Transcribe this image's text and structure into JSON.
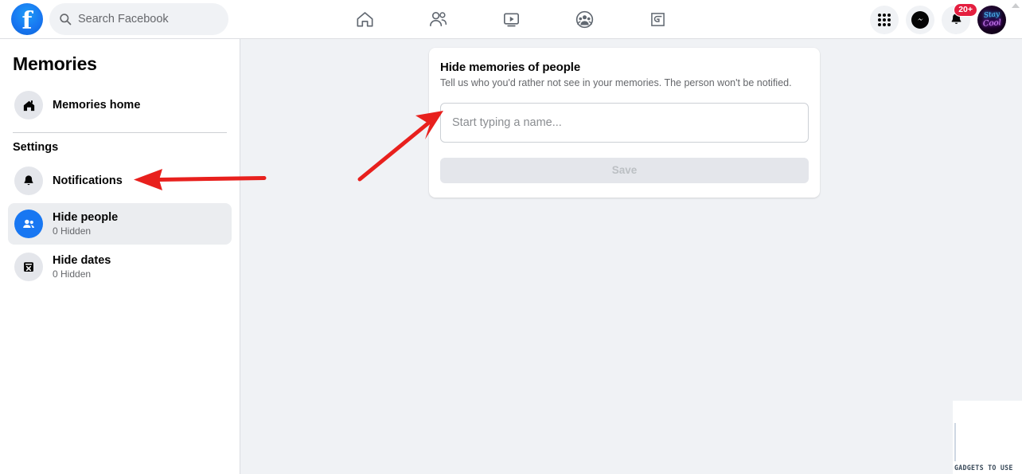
{
  "header": {
    "logo_icon": "facebook-logo-icon",
    "search": {
      "icon": "search-icon",
      "placeholder": "Search Facebook",
      "value": "Search Facebook"
    },
    "nav": [
      {
        "name": "home-icon",
        "label": "Home"
      },
      {
        "name": "friends-icon",
        "label": "Friends"
      },
      {
        "name": "watch-video-icon",
        "label": "Watch"
      },
      {
        "name": "groups-icon",
        "label": "Groups"
      },
      {
        "name": "gaming-icon",
        "label": "Gaming"
      }
    ],
    "right": {
      "menu_icon": "apps-grid-icon",
      "messenger_icon": "messenger-icon",
      "notifications_icon": "bell-icon",
      "notifications_badge": "20+",
      "avatar_icon": "profile-avatar",
      "avatar_line1": "Stay",
      "avatar_line2": "Cool"
    }
  },
  "sidebar": {
    "title": "Memories",
    "home_item": {
      "icon": "house-icon",
      "label": "Memories home"
    },
    "section_label": "Settings",
    "items": [
      {
        "icon": "bell-icon",
        "label": "Notifications",
        "sub": "",
        "active": false
      },
      {
        "icon": "people-icon",
        "label": "Hide people",
        "sub": "0 Hidden",
        "active": true
      },
      {
        "icon": "calendar-x-icon",
        "label": "Hide dates",
        "sub": "0 Hidden",
        "active": false
      }
    ]
  },
  "main": {
    "card": {
      "title": "Hide memories of people",
      "subtitle": "Tell us who you'd rather not see in your memories. The person won't be notified.",
      "input_placeholder": "Start typing a name...",
      "input_value": "",
      "save_label": "Save",
      "save_disabled": true
    }
  },
  "annotations": [
    {
      "name": "arrow-to-hide-people",
      "direction": "left",
      "color": "#e8201d"
    },
    {
      "name": "arrow-to-name-input",
      "direction": "up-right",
      "color": "#e8201d"
    }
  ],
  "watermark": {
    "text": "GADGETS TO USE"
  },
  "colors": {
    "page_bg": "#f0f2f5",
    "card_bg": "#ffffff",
    "accent_blue": "#1877f2",
    "badge_red": "#e41e3f",
    "annotation_red": "#e8201d",
    "text_primary": "#050505",
    "text_secondary": "#65676b"
  }
}
